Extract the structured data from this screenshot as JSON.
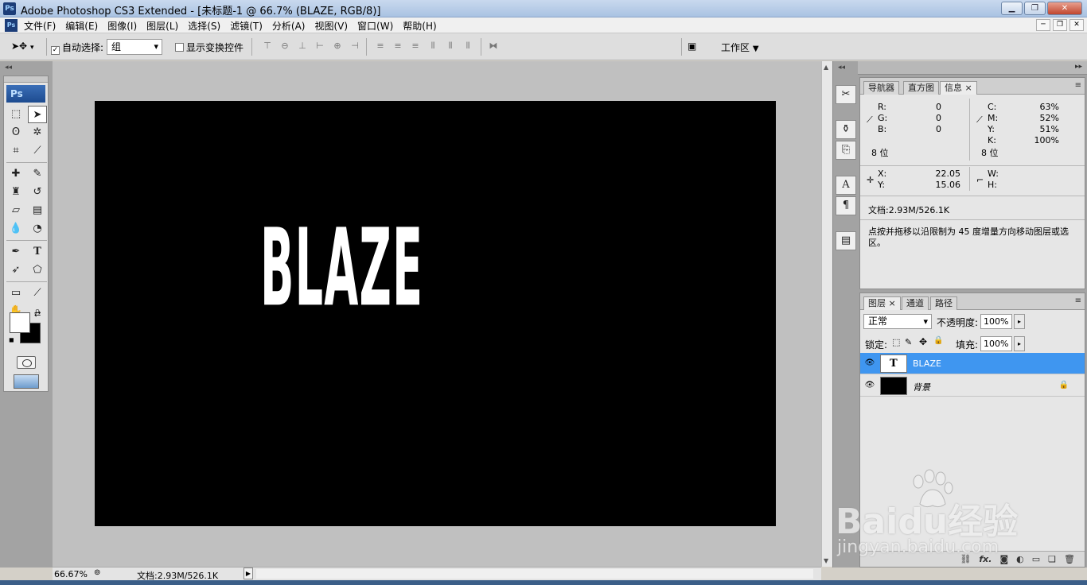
{
  "app": {
    "title": "Adobe Photoshop CS3 Extended - [未标题-1 @ 66.7% (BLAZE, RGB/8)]",
    "logo_text": "Ps"
  },
  "menu": {
    "items": [
      "文件(F)",
      "编辑(E)",
      "图像(I)",
      "图层(L)",
      "选择(S)",
      "滤镜(T)",
      "分析(A)",
      "视图(V)",
      "窗口(W)",
      "帮助(H)"
    ]
  },
  "options": {
    "auto_select_label": "自动选择:",
    "auto_select_value": "组",
    "show_transform_label": "显示变换控件",
    "workspace_label": "工作区",
    "auto_select_checked": true,
    "show_transform_checked": false
  },
  "toolbox": {
    "badge": "Ps"
  },
  "canvas": {
    "text": "BLAZE"
  },
  "status": {
    "zoom": "66.67%",
    "doc": "文档:2.93M/526.1K"
  },
  "info_panel": {
    "tabs": [
      "导航器",
      "直方图",
      "信息"
    ],
    "active_tab": "信息",
    "r_label": "R:",
    "r_value": "0",
    "g_label": "G:",
    "g_value": "0",
    "b_label": "B:",
    "b_value": "0",
    "c_label": "C:",
    "c_value": "63%",
    "m_label": "M:",
    "m_value": "52%",
    "y_label": "Y:",
    "y_value": "51%",
    "k_label": "K:",
    "k_value": "100%",
    "bits_left": "8 位",
    "bits_right": "8 位",
    "x_label": "X:",
    "x_value": "22.05",
    "y2_label": "Y:",
    "y2_value": "15.06",
    "w_label": "W:",
    "h_label": "H:",
    "doc_size": "文档:2.93M/526.1K",
    "hint": "点按并拖移以沿限制为 45 度增量方向移动图层或选区。"
  },
  "layers_panel": {
    "tabs": [
      "图层",
      "通道",
      "路径"
    ],
    "active_tab": "图层",
    "blend_mode": "正常",
    "opacity_label": "不透明度:",
    "opacity_value": "100%",
    "lock_label": "锁定:",
    "fill_label": "填充:",
    "fill_value": "100%",
    "layers": [
      {
        "name": "BLAZE",
        "thumb_text": "T"
      },
      {
        "name": "背景"
      }
    ],
    "footer_icons": [
      "link-icon",
      "fx-icon",
      "mask-icon",
      "adjustment-icon",
      "group-icon",
      "new-layer-icon",
      "trash-icon"
    ]
  },
  "watermark": {
    "main": "Baidu经验",
    "sub": "jingyan.baidu.com"
  },
  "colors": {
    "selected_layer": "#3f96f0",
    "canvas_bg": "#000000",
    "workspace_bg": "#c0c0c0"
  }
}
